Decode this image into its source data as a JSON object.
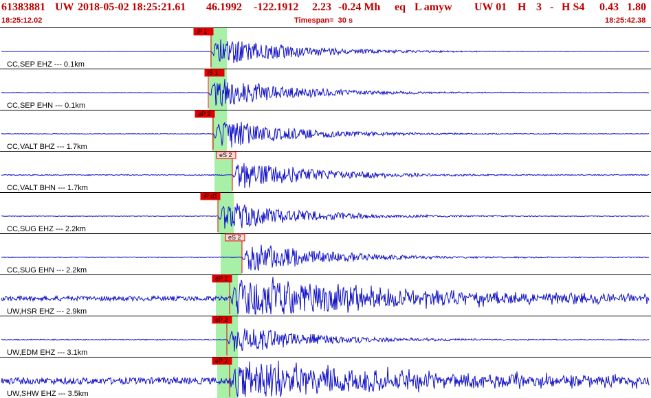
{
  "header": {
    "event_id": "61383881",
    "network": "UW",
    "datetime": "2018-05-02 18:25:21.61",
    "lat": "46.1992",
    "lon": "-122.1912",
    "depth": "2.23",
    "magnitude": "-0.24 Mh",
    "type": "eq",
    "flags": "L amyw",
    "net_auth": "UW 01",
    "h_flag": "H",
    "num": "3",
    "dash": "-",
    "hs": "H S4",
    "rms": "0.43",
    "err": "1.80",
    "start_time": "18:25:12.02",
    "timespan_label": "Timespan=  30 s",
    "end_time": "18:25:42.38"
  },
  "colors": {
    "header_text": "#c00000",
    "waveform": "#1010c8",
    "separator": "#000000",
    "zero_line": "#0000cc",
    "pick_window": "#a8f0a8",
    "pick_box": "#e00000",
    "pick_line": "#e00000"
  },
  "traces": [
    {
      "label": "CC,SEP EHZ --- 0.1km",
      "picks": [
        {
          "text": "iP 1",
          "style": "solid"
        }
      ],
      "amp": "med",
      "noise": 0.02
    },
    {
      "label": "CC,SEP EHN --- 0.1km",
      "picks": [
        {
          "text": "iS 1",
          "style": "solid"
        }
      ],
      "amp": "med",
      "noise": 0.03
    },
    {
      "label": "CC,VALT BHZ --- 1.7km",
      "picks": [
        {
          "text": "eP 2",
          "style": "solid"
        }
      ],
      "amp": "med",
      "noise": 0.03
    },
    {
      "label": "CC,VALT BHN --- 1.7km",
      "picks": [
        {
          "text": "eS 2",
          "style": "outline"
        }
      ],
      "amp": "med",
      "noise": 0.05
    },
    {
      "label": "CC,SUG EHZ --- 2.2km",
      "picks": [
        {
          "text": "iP d1",
          "style": "solid"
        }
      ],
      "amp": "med",
      "noise": 0.03
    },
    {
      "label": "CC,SUG EHN --- 2.2km",
      "picks": [
        {
          "text": "eS 2",
          "style": "outline"
        }
      ],
      "amp": "med",
      "noise": 0.04
    },
    {
      "label": "UW,HSR EHZ --- 2.9km",
      "picks": [
        {
          "text": "eP 2",
          "style": "solid"
        }
      ],
      "amp": "high",
      "noise": 0.25
    },
    {
      "label": "UW,EDM EHZ --- 3.1km",
      "picks": [
        {
          "text": "eP 2",
          "style": "solid"
        }
      ],
      "amp": "med",
      "noise": 0.05
    },
    {
      "label": "UW,SHW EHZ --- 3.5km",
      "picks": [
        {
          "text": "eP 2",
          "style": "solid"
        }
      ],
      "amp": "high",
      "noise": 0.35
    }
  ]
}
